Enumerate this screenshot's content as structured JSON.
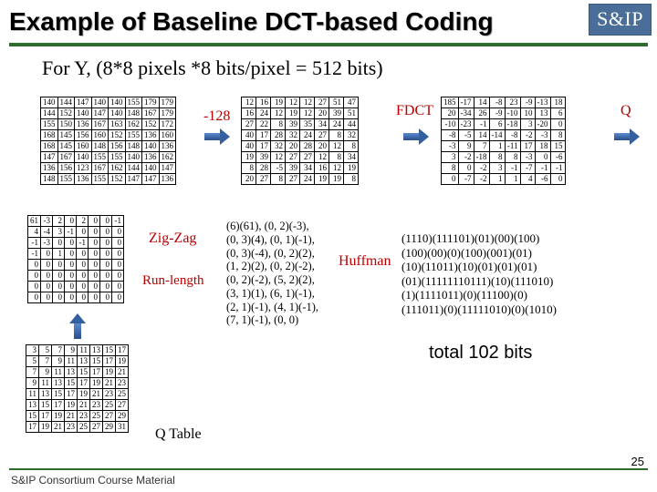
{
  "title": "Example of Baseline DCT-based Coding",
  "logo": "S&IP",
  "subtitle": "For Y, (8*8 pixels *8 bits/pixel = 512 bits)",
  "labels": {
    "minus128": "-128",
    "fdct": "FDCT",
    "q": "Q",
    "zigzag": "Zig-Zag",
    "runlength": "Run-length",
    "huffman": "Huffman",
    "qtable": "Q Table",
    "total": "total 102 bits"
  },
  "footer": "S&IP Consortium Course Material",
  "pagenum": "25",
  "m_src": [
    [
      140,
      144,
      147,
      140,
      140,
      155,
      179,
      179
    ],
    [
      144,
      152,
      140,
      147,
      140,
      148,
      167,
      179
    ],
    [
      155,
      150,
      136,
      167,
      163,
      162,
      152,
      172
    ],
    [
      168,
      145,
      156,
      160,
      152,
      155,
      136,
      160
    ],
    [
      168,
      145,
      160,
      148,
      156,
      148,
      140,
      136
    ],
    [
      147,
      167,
      140,
      155,
      155,
      140,
      136,
      162
    ],
    [
      136,
      156,
      123,
      167,
      162,
      144,
      140,
      147
    ],
    [
      148,
      155,
      136,
      155,
      152,
      147,
      147,
      136
    ]
  ],
  "m_shift": [
    [
      12,
      16,
      19,
      12,
      12,
      27,
      51,
      47
    ],
    [
      16,
      24,
      12,
      19,
      12,
      20,
      39,
      51
    ],
    [
      27,
      22,
      8,
      39,
      35,
      34,
      24,
      44
    ],
    [
      40,
      17,
      28,
      32,
      24,
      27,
      8,
      32
    ],
    [
      40,
      17,
      32,
      20,
      28,
      20,
      12,
      8
    ],
    [
      19,
      39,
      12,
      27,
      27,
      12,
      8,
      34
    ],
    [
      8,
      28,
      -5,
      39,
      34,
      16,
      12,
      19
    ],
    [
      20,
      27,
      8,
      27,
      24,
      19,
      19,
      8
    ]
  ],
  "m_fdct": [
    [
      185,
      -17,
      14,
      -8,
      23,
      -9,
      -13,
      18
    ],
    [
      20,
      -34,
      26,
      -9,
      -10,
      10,
      13,
      6
    ],
    [
      -10,
      -23,
      -1,
      6,
      -18,
      3,
      -20,
      0
    ],
    [
      -8,
      -5,
      14,
      -14,
      -8,
      -2,
      -3,
      8
    ],
    [
      -3,
      9,
      7,
      1,
      -11,
      17,
      18,
      15
    ],
    [
      3,
      -2,
      -18,
      8,
      8,
      -3,
      0,
      -6
    ],
    [
      8,
      0,
      -2,
      3,
      -1,
      -7,
      -1,
      -1
    ],
    [
      0,
      -7,
      -2,
      1,
      1,
      4,
      -6,
      0
    ]
  ],
  "m_q": [
    [
      61,
      -3,
      2,
      0,
      2,
      0,
      0,
      -1
    ],
    [
      4,
      -4,
      3,
      -1,
      0,
      0,
      0,
      0
    ],
    [
      -1,
      -3,
      0,
      0,
      -1,
      0,
      0,
      0
    ],
    [
      -1,
      0,
      1,
      0,
      0,
      0,
      0,
      0
    ],
    [
      0,
      0,
      0,
      0,
      0,
      0,
      0,
      0
    ],
    [
      0,
      0,
      0,
      0,
      0,
      0,
      0,
      0
    ],
    [
      0,
      0,
      0,
      0,
      0,
      0,
      0,
      0
    ],
    [
      0,
      0,
      0,
      0,
      0,
      0,
      0,
      0
    ]
  ],
  "m_qtbl": [
    [
      3,
      5,
      7,
      9,
      11,
      13,
      15,
      17
    ],
    [
      5,
      7,
      9,
      11,
      13,
      15,
      17,
      19
    ],
    [
      7,
      9,
      11,
      13,
      15,
      17,
      19,
      21
    ],
    [
      9,
      11,
      13,
      15,
      17,
      19,
      21,
      23
    ],
    [
      11,
      13,
      15,
      17,
      19,
      21,
      23,
      25
    ],
    [
      13,
      15,
      17,
      19,
      21,
      23,
      25,
      27
    ],
    [
      15,
      17,
      19,
      21,
      23,
      25,
      27,
      29
    ],
    [
      17,
      19,
      21,
      23,
      25,
      27,
      29,
      31
    ]
  ],
  "runlen_lines": [
    "(6)(61), (0, 2)(-3),",
    "(0, 3)(4), (0, 1)(-1),",
    "(0, 3)(-4), (0, 2)(2),",
    "(1, 2)(2), (0, 2)(-2),",
    "(0, 2)(-2), (5, 2)(2),",
    "(3, 1)(1), (6, 1)(-1),",
    "(2, 1)(-1), (4, 1)(-1),",
    "(7, 1)(-1), (0, 0)"
  ],
  "huff_lines": [
    "(1110)(111101)(01)(00)(100)",
    "(100)(00)(0)(100)(001)(01)",
    "(10)(11011)(10)(01)(01)(01)",
    "(01)(11111110111)(10)(111010)",
    "(1)(1111011)(0)(11100)(0)",
    "(111011)(0)(11111010)(0)(1010)"
  ]
}
